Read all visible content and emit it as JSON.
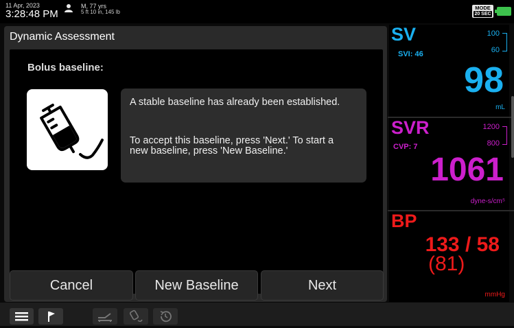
{
  "status_bar": {
    "date": "11 Apr, 2023",
    "time": "3:28:48 PM",
    "patient_line1": "M, 77 yrs",
    "patient_line2": "5 ft 10 in, 145 lb",
    "mode_top": "MODE",
    "mode_bottom": "20 SEC",
    "icons": [
      "patient-icon",
      "battery-icon"
    ]
  },
  "dialog": {
    "title": "Dynamic Assessment",
    "section_label": "Bolus baseline:",
    "message_line1": "A stable baseline has already been established.",
    "message_line2": "To accept this baseline, press 'Next.' To start a new baseline, press 'New Baseline.'",
    "icon": "iv-bag-icon",
    "buttons": {
      "cancel": "Cancel",
      "new_baseline": "New Baseline",
      "next": "Next"
    }
  },
  "tiles": {
    "sv": {
      "label": "SV",
      "sub": "SVI: 46",
      "value": "98",
      "unit": "mL",
      "range_high": "100",
      "range_low": "60",
      "color": "#1ab0f0"
    },
    "svr": {
      "label": "SVR",
      "sub": "CVP: 7",
      "value": "1061",
      "unit": "dyne-s/cm⁵",
      "range_high": "1200",
      "range_low": "800",
      "color": "#cc1fcc"
    },
    "bp": {
      "label": "BP",
      "value": "133 / 58",
      "map": "(81)",
      "unit": "mmHg",
      "color": "#ee1a1a"
    }
  },
  "toolbar": {
    "icons": [
      "menu-icon",
      "flag-icon",
      "bed-icon",
      "bolus-icon",
      "history-icon"
    ]
  }
}
